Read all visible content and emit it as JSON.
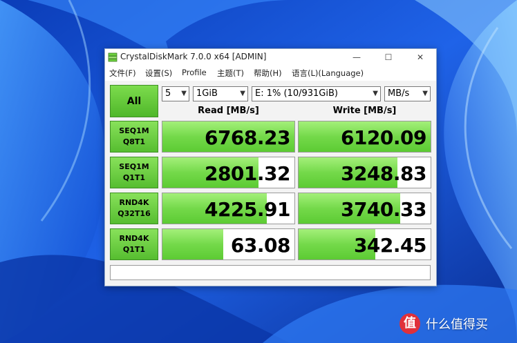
{
  "window": {
    "title": "CrystalDiskMark 7.0.0 x64 [ADMIN]",
    "controls": {
      "minimize": "—",
      "maximize": "☐",
      "close": "✕"
    }
  },
  "menu": [
    "文件(F)",
    "设置(S)",
    "Profile",
    "主题(T)",
    "帮助(H)",
    "语言(L)(Language)"
  ],
  "toolbar": {
    "all_label": "All",
    "count": "5",
    "size": "1GiB",
    "drive": "E: 1% (10/931GiB)",
    "unit": "MB/s"
  },
  "columns": {
    "read": "Read [MB/s]",
    "write": "Write [MB/s]"
  },
  "tests": [
    {
      "line1": "SEQ1M",
      "line2": "Q8T1",
      "read": "6768.23",
      "write": "6120.09",
      "read_fill": 1.0,
      "write_fill": 1.0
    },
    {
      "line1": "SEQ1M",
      "line2": "Q1T1",
      "read": "2801.32",
      "write": "3248.83",
      "read_fill": 0.73,
      "write_fill": 0.75
    },
    {
      "line1": "RND4K",
      "line2": "Q32T16",
      "read": "4225.91",
      "write": "3740.33",
      "read_fill": 0.79,
      "write_fill": 0.77
    },
    {
      "line1": "RND4K",
      "line2": "Q1T1",
      "read": "63.08",
      "write": "342.45",
      "read_fill": 0.46,
      "write_fill": 0.58
    }
  ],
  "watermark": {
    "logo": "值",
    "text": "什么值得买"
  },
  "colors": {
    "accent_green": "#5ccb33",
    "wallpaper_blue": "#1a4fd6"
  }
}
